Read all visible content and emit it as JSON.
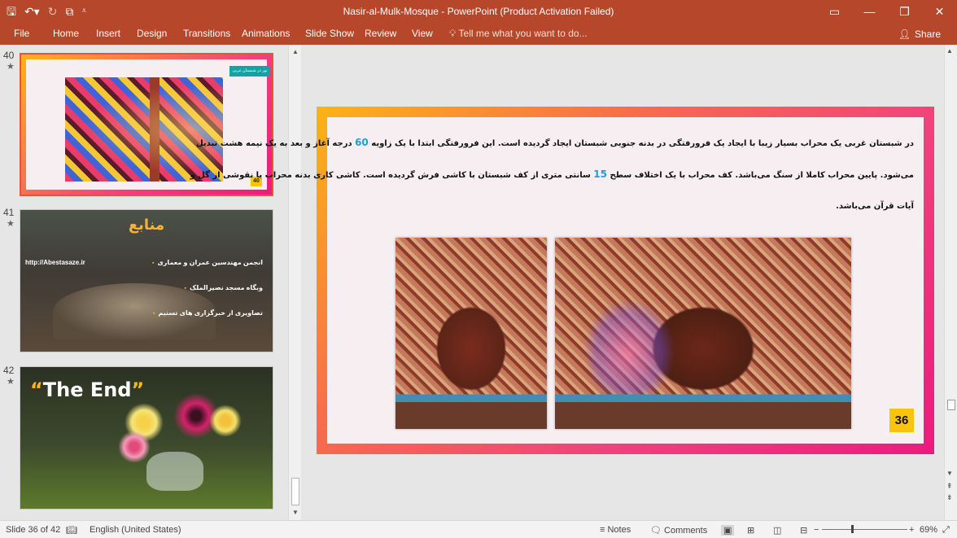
{
  "titlebar": {
    "title": "Nasir-al-Mulk-Mosque - PowerPoint (Product Activation Failed)",
    "qat_icons": [
      "save-icon",
      "undo-icon",
      "redo-icon",
      "present-icon",
      "customize-icon"
    ],
    "window_controls": [
      "ribbon-display-icon",
      "minimize-icon",
      "restore-icon",
      "close-icon"
    ]
  },
  "ribbon": {
    "tabs": [
      "File",
      "Home",
      "Insert",
      "Design",
      "Transitions",
      "Animations",
      "Slide Show",
      "Review",
      "View"
    ],
    "tell_me": "Tell me what you want to do...",
    "share": "Share"
  },
  "thumbnails": [
    {
      "number": "40",
      "star": "★",
      "caption": "نور در شبستان غربی",
      "slide_no": "40"
    },
    {
      "number": "41",
      "star": "★",
      "title": "منابع",
      "link": "http://Abestasaze.ir",
      "items": [
        "انجمن مهندسین عمران و معماری",
        "وبگاه مسجد نصیرالملک",
        "تصاویری از خبرگزاری های تسنیم"
      ]
    },
    {
      "number": "42",
      "star": "★",
      "end_text": "The End",
      "quote_open": "“",
      "quote_close": "”"
    }
  ],
  "slide": {
    "line1_a": "در شبستان غربی یک محراب بسیار زیبا با ایجاد یک فرورفتگی در بدنه جنوبی شبستان ایجاد گردیده است. این فرورفتگی ابتدا با یک زاویه ",
    "line1_num": "60",
    "line1_b": " درجه آغاز و بعد به یک نیمه هشت تبدیل",
    "line2_a": "می‌شود. پایین محراب کاملا از سنگ می‌باشد. کف محراب با یک اختلاف سطح ",
    "line2_num": "15",
    "line2_b": " سانتی متری از کف شبستان با کاشی فرش گردیده است. کاشی کاری بدنه محراب با نقوشی از گل و",
    "line3": "آیات قرآن می‌باشد.",
    "slide_number": "36"
  },
  "status": {
    "slide_of": "Slide 36 of 42",
    "language": "English (United States)",
    "notes": "Notes",
    "comments": "Comments",
    "zoom": "69%",
    "zoom_level": 0.69
  },
  "colors": {
    "ribbon": "#b7472a",
    "gradient_start": "#fcb316",
    "gradient_end": "#ec1b7e",
    "slide_number_bg": "#fcc30b",
    "highlight_number": "#1aa0d8"
  }
}
